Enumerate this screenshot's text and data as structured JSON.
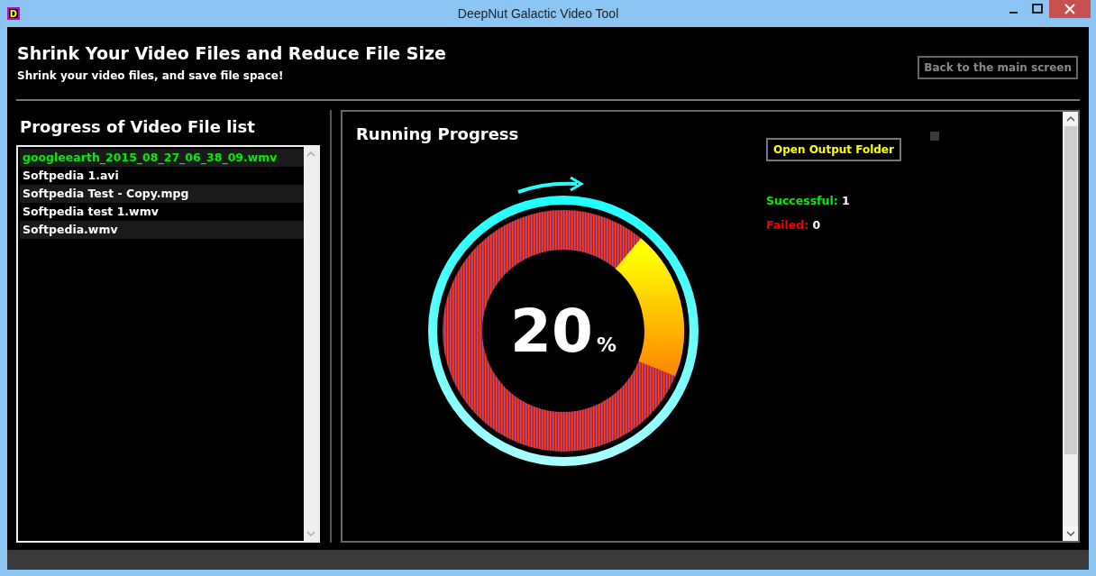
{
  "window": {
    "title": "DeepNut Galactic Video Tool",
    "app_icon_letter": "D"
  },
  "header": {
    "title": "Shrink Your Video Files and Reduce File Size",
    "subtitle": "Shrink your video files, and save file space!",
    "back_button": "Back to the main screen"
  },
  "file_list": {
    "heading": "Progress of Video File list",
    "items": [
      {
        "name": "googleearth_2015_08_27_06_38_09.wmv",
        "completed": true
      },
      {
        "name": "Softpedia 1.avi",
        "completed": false
      },
      {
        "name": "Softpedia Test - Copy.mpg",
        "completed": false
      },
      {
        "name": "Softpedia test 1.wmv",
        "completed": false
      },
      {
        "name": "Softpedia.wmv",
        "completed": false
      }
    ]
  },
  "progress": {
    "heading": "Running Progress",
    "level": 0.2,
    "value": "20",
    "unit": "%",
    "open_button": "Open Output Folder",
    "successful_label": "Successful:",
    "successful_count": "1",
    "failed_label": "Failed:",
    "failed_count": "0"
  }
}
